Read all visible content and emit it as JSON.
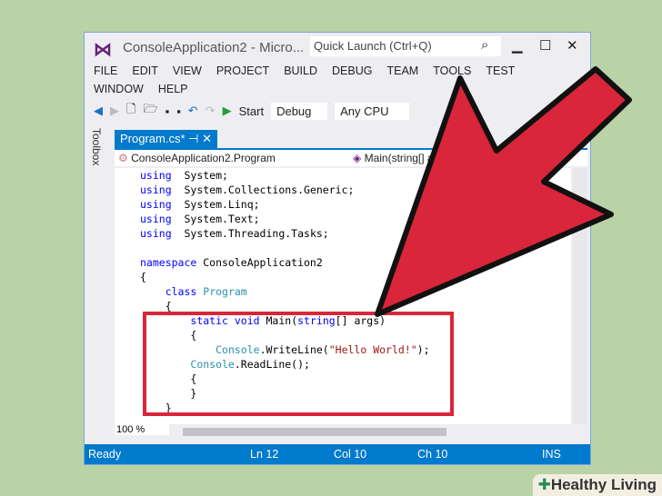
{
  "window": {
    "title": "ConsoleApplication2 - Micro...",
    "quick_launch": "Quick Launch (Ctrl+Q)"
  },
  "menu": [
    "FILE",
    "EDIT",
    "VIEW",
    "PROJECT",
    "BUILD",
    "DEBUG",
    "TEAM",
    "TOOLS",
    "TEST",
    "WINDOW",
    "HELP"
  ],
  "toolbar": {
    "start": "Start",
    "config": "Debug",
    "platform": "Any CPU"
  },
  "toolbox": "Toolbox",
  "tab": {
    "label": "Program.cs*"
  },
  "nav": {
    "class": "ConsoleApplication2.Program",
    "member": "Main(string[] args)"
  },
  "code": [
    [
      [
        "kw",
        "using"
      ],
      [
        "",
        "  System;"
      ]
    ],
    [
      [
        "kw",
        "using"
      ],
      [
        "",
        "  System.Collections.Generic;"
      ]
    ],
    [
      [
        "kw",
        "using"
      ],
      [
        "",
        "  System.Linq;"
      ]
    ],
    [
      [
        "kw",
        "using"
      ],
      [
        "",
        "  System.Text;"
      ]
    ],
    [
      [
        "kw",
        "using"
      ],
      [
        "",
        "  System.Threading.Tasks;"
      ]
    ],
    [],
    [
      [
        "kw",
        "namespace"
      ],
      [
        "",
        " ConsoleApplication2"
      ]
    ],
    [
      [
        "",
        "{"
      ]
    ],
    [
      [
        "",
        "    "
      ],
      [
        "kw",
        "class"
      ],
      [
        "",
        " "
      ],
      [
        "ty",
        "Program"
      ]
    ],
    [
      [
        "",
        "    {"
      ]
    ],
    [
      [
        "",
        "        "
      ],
      [
        "kw",
        "static"
      ],
      [
        "",
        " "
      ],
      [
        "kw",
        "void"
      ],
      [
        "",
        " Main("
      ],
      [
        "kw",
        "string"
      ],
      [
        "",
        "[] args)"
      ]
    ],
    [
      [
        "",
        "        {"
      ]
    ],
    [
      [
        "",
        "            "
      ],
      [
        "ty",
        "Console"
      ],
      [
        "",
        ".WriteLine("
      ],
      [
        "st",
        "\"Hello World!\""
      ],
      [
        "",
        ");"
      ]
    ],
    [
      [
        "",
        "        "
      ],
      [
        "ty",
        "Console"
      ],
      [
        "",
        ".ReadLine();"
      ]
    ],
    [
      [
        "",
        "        {"
      ]
    ],
    [
      [
        "",
        "        }"
      ]
    ],
    [
      [
        "",
        "    }"
      ]
    ]
  ],
  "zoom": "100 %",
  "status": {
    "state": "Ready",
    "ln": "Ln 12",
    "col": "Col 10",
    "ch": "Ch 10",
    "mode": "INS"
  },
  "watermark": "Healthy Living"
}
